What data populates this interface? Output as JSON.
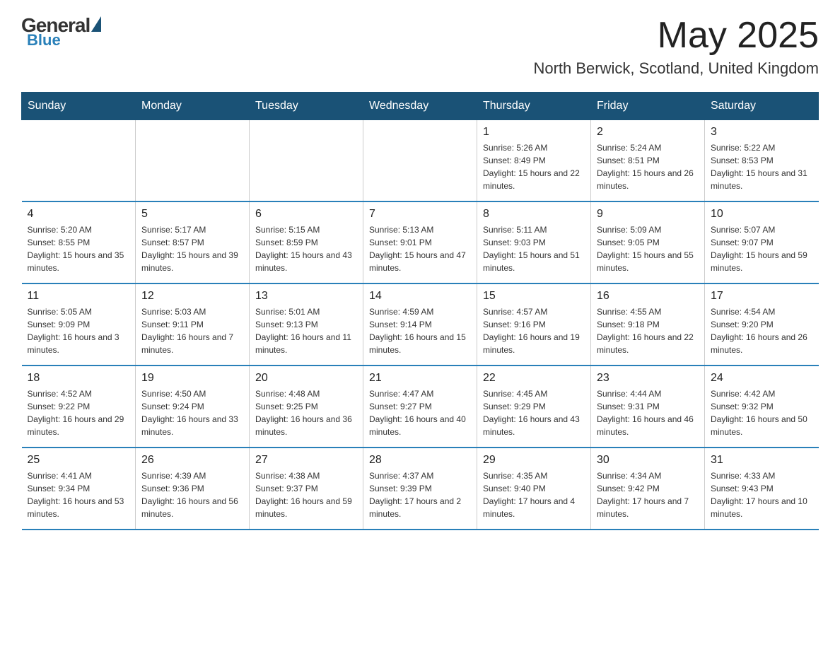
{
  "logo": {
    "general": "General",
    "blue": "Blue"
  },
  "header": {
    "month": "May 2025",
    "location": "North Berwick, Scotland, United Kingdom"
  },
  "weekdays": [
    "Sunday",
    "Monday",
    "Tuesday",
    "Wednesday",
    "Thursday",
    "Friday",
    "Saturday"
  ],
  "weeks": [
    [
      {
        "day": "",
        "info": ""
      },
      {
        "day": "",
        "info": ""
      },
      {
        "day": "",
        "info": ""
      },
      {
        "day": "",
        "info": ""
      },
      {
        "day": "1",
        "info": "Sunrise: 5:26 AM\nSunset: 8:49 PM\nDaylight: 15 hours and 22 minutes."
      },
      {
        "day": "2",
        "info": "Sunrise: 5:24 AM\nSunset: 8:51 PM\nDaylight: 15 hours and 26 minutes."
      },
      {
        "day": "3",
        "info": "Sunrise: 5:22 AM\nSunset: 8:53 PM\nDaylight: 15 hours and 31 minutes."
      }
    ],
    [
      {
        "day": "4",
        "info": "Sunrise: 5:20 AM\nSunset: 8:55 PM\nDaylight: 15 hours and 35 minutes."
      },
      {
        "day": "5",
        "info": "Sunrise: 5:17 AM\nSunset: 8:57 PM\nDaylight: 15 hours and 39 minutes."
      },
      {
        "day": "6",
        "info": "Sunrise: 5:15 AM\nSunset: 8:59 PM\nDaylight: 15 hours and 43 minutes."
      },
      {
        "day": "7",
        "info": "Sunrise: 5:13 AM\nSunset: 9:01 PM\nDaylight: 15 hours and 47 minutes."
      },
      {
        "day": "8",
        "info": "Sunrise: 5:11 AM\nSunset: 9:03 PM\nDaylight: 15 hours and 51 minutes."
      },
      {
        "day": "9",
        "info": "Sunrise: 5:09 AM\nSunset: 9:05 PM\nDaylight: 15 hours and 55 minutes."
      },
      {
        "day": "10",
        "info": "Sunrise: 5:07 AM\nSunset: 9:07 PM\nDaylight: 15 hours and 59 minutes."
      }
    ],
    [
      {
        "day": "11",
        "info": "Sunrise: 5:05 AM\nSunset: 9:09 PM\nDaylight: 16 hours and 3 minutes."
      },
      {
        "day": "12",
        "info": "Sunrise: 5:03 AM\nSunset: 9:11 PM\nDaylight: 16 hours and 7 minutes."
      },
      {
        "day": "13",
        "info": "Sunrise: 5:01 AM\nSunset: 9:13 PM\nDaylight: 16 hours and 11 minutes."
      },
      {
        "day": "14",
        "info": "Sunrise: 4:59 AM\nSunset: 9:14 PM\nDaylight: 16 hours and 15 minutes."
      },
      {
        "day": "15",
        "info": "Sunrise: 4:57 AM\nSunset: 9:16 PM\nDaylight: 16 hours and 19 minutes."
      },
      {
        "day": "16",
        "info": "Sunrise: 4:55 AM\nSunset: 9:18 PM\nDaylight: 16 hours and 22 minutes."
      },
      {
        "day": "17",
        "info": "Sunrise: 4:54 AM\nSunset: 9:20 PM\nDaylight: 16 hours and 26 minutes."
      }
    ],
    [
      {
        "day": "18",
        "info": "Sunrise: 4:52 AM\nSunset: 9:22 PM\nDaylight: 16 hours and 29 minutes."
      },
      {
        "day": "19",
        "info": "Sunrise: 4:50 AM\nSunset: 9:24 PM\nDaylight: 16 hours and 33 minutes."
      },
      {
        "day": "20",
        "info": "Sunrise: 4:48 AM\nSunset: 9:25 PM\nDaylight: 16 hours and 36 minutes."
      },
      {
        "day": "21",
        "info": "Sunrise: 4:47 AM\nSunset: 9:27 PM\nDaylight: 16 hours and 40 minutes."
      },
      {
        "day": "22",
        "info": "Sunrise: 4:45 AM\nSunset: 9:29 PM\nDaylight: 16 hours and 43 minutes."
      },
      {
        "day": "23",
        "info": "Sunrise: 4:44 AM\nSunset: 9:31 PM\nDaylight: 16 hours and 46 minutes."
      },
      {
        "day": "24",
        "info": "Sunrise: 4:42 AM\nSunset: 9:32 PM\nDaylight: 16 hours and 50 minutes."
      }
    ],
    [
      {
        "day": "25",
        "info": "Sunrise: 4:41 AM\nSunset: 9:34 PM\nDaylight: 16 hours and 53 minutes."
      },
      {
        "day": "26",
        "info": "Sunrise: 4:39 AM\nSunset: 9:36 PM\nDaylight: 16 hours and 56 minutes."
      },
      {
        "day": "27",
        "info": "Sunrise: 4:38 AM\nSunset: 9:37 PM\nDaylight: 16 hours and 59 minutes."
      },
      {
        "day": "28",
        "info": "Sunrise: 4:37 AM\nSunset: 9:39 PM\nDaylight: 17 hours and 2 minutes."
      },
      {
        "day": "29",
        "info": "Sunrise: 4:35 AM\nSunset: 9:40 PM\nDaylight: 17 hours and 4 minutes."
      },
      {
        "day": "30",
        "info": "Sunrise: 4:34 AM\nSunset: 9:42 PM\nDaylight: 17 hours and 7 minutes."
      },
      {
        "day": "31",
        "info": "Sunrise: 4:33 AM\nSunset: 9:43 PM\nDaylight: 17 hours and 10 minutes."
      }
    ]
  ]
}
